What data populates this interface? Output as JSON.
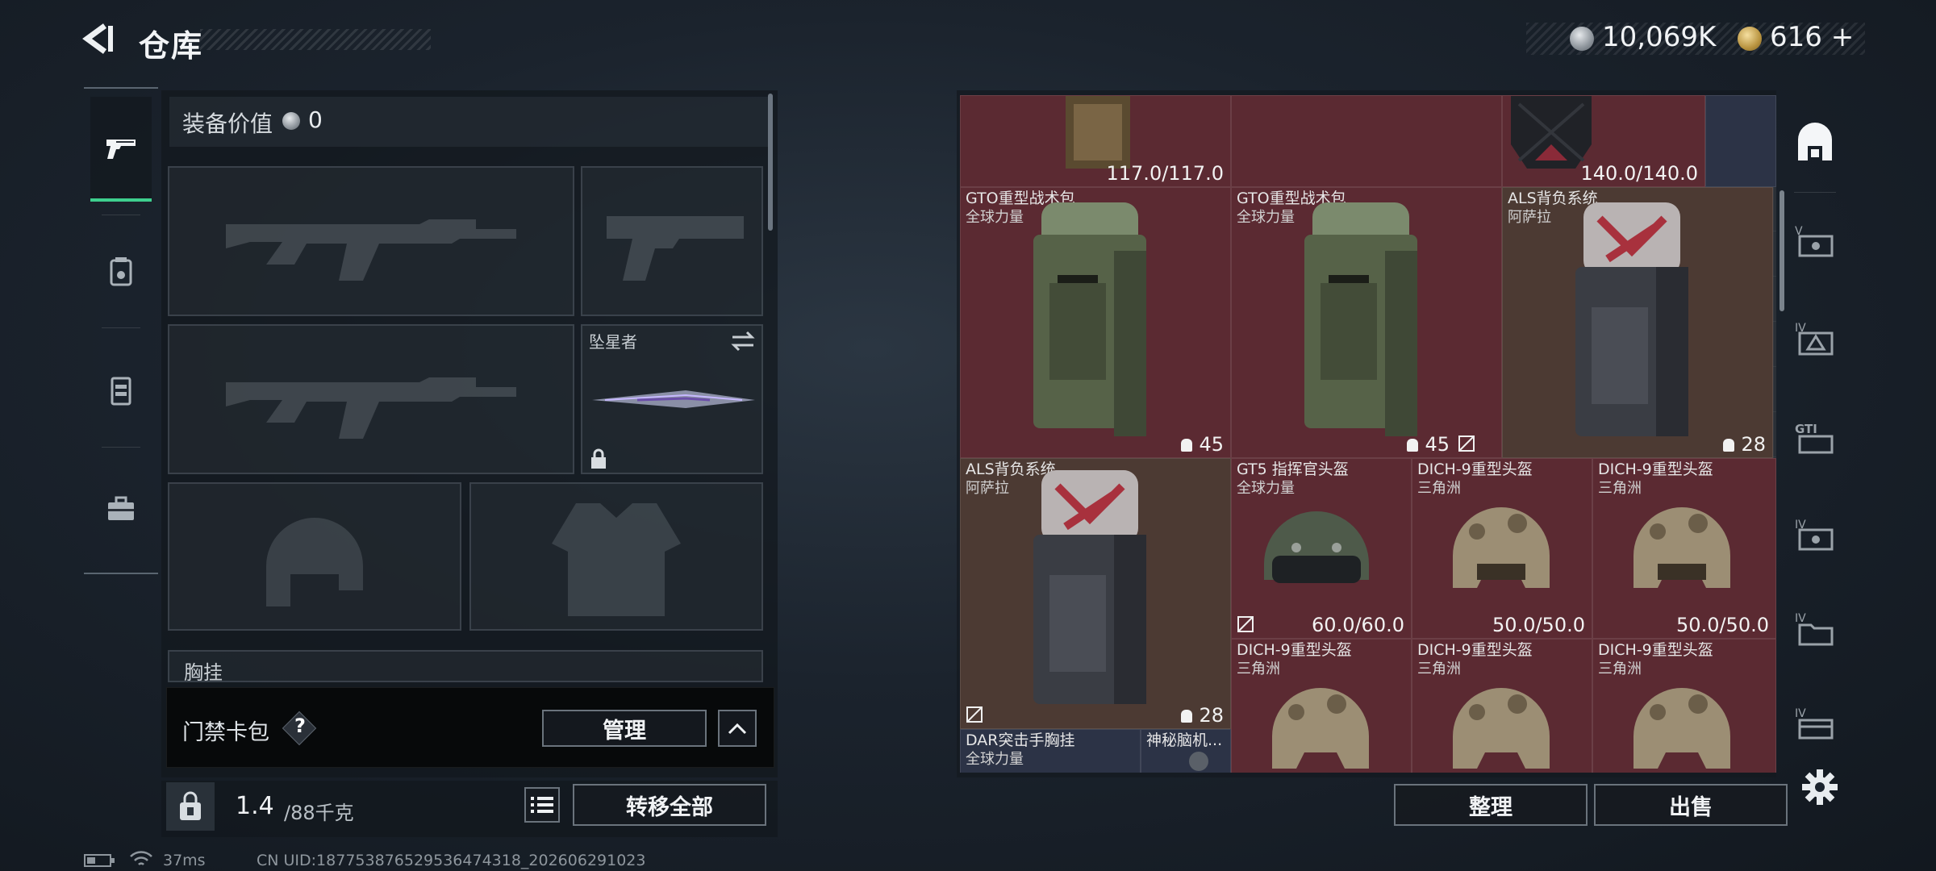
{
  "header": {
    "title": "仓库",
    "currency": {
      "silver": "10,069K",
      "gold": "616",
      "gold_add": "+"
    }
  },
  "left_rail": [
    {
      "name": "tab-weapons",
      "icon": "pistol-icon",
      "active": true
    },
    {
      "name": "tab-armor",
      "icon": "backpack-armor-icon",
      "active": false
    },
    {
      "name": "tab-rig",
      "icon": "chest-rig-icon",
      "active": false
    },
    {
      "name": "tab-case",
      "icon": "briefcase-icon",
      "active": false
    }
  ],
  "equipment": {
    "value_label": "装备价值",
    "value": "0",
    "melee_name": "坠星者",
    "partial_label": "胸挂",
    "access_card_label": "门禁卡包",
    "help_glyph": "?",
    "manage_label": "管理",
    "weight_current": "1.4",
    "weight_max": "/88千克",
    "transfer_all_label": "转移全部"
  },
  "grid_items": [
    {
      "name": "",
      "sub": "",
      "dur": "117.0/117.0",
      "cap": ""
    },
    {
      "name": "",
      "sub": "",
      "dur": "140.0/140.0",
      "cap": ""
    },
    {
      "name": "GTO重型战术包",
      "sub": "全球力量",
      "dur": "",
      "cap": "45"
    },
    {
      "name": "GTO重型战术包",
      "sub": "全球力量",
      "dur": "",
      "cap": "45"
    },
    {
      "name": "ALS背负系统",
      "sub": "阿萨拉",
      "dur": "",
      "cap": "28"
    },
    {
      "name": "ALS背负系统",
      "sub": "阿萨拉",
      "dur": "",
      "cap": "28"
    },
    {
      "name": "GT5 指挥官头盔",
      "sub": "全球力量",
      "dur": "60.0/60.0",
      "cap": ""
    },
    {
      "name": "DICH-9重型头盔",
      "sub": "三角洲",
      "dur": "50.0/50.0",
      "cap": ""
    },
    {
      "name": "DICH-9重型头盔",
      "sub": "三角洲",
      "dur": "50.0/50.0",
      "cap": ""
    },
    {
      "name": "DICH-9重型头盔",
      "sub": "三角洲",
      "dur": "",
      "cap": ""
    },
    {
      "name": "DICH-9重型头盔",
      "sub": "三角洲",
      "dur": "",
      "cap": ""
    },
    {
      "name": "DICH-9重型头盔",
      "sub": "三角洲",
      "dur": "",
      "cap": ""
    },
    {
      "name": "DAR突击手胸挂",
      "sub": "全球力量",
      "dur": "",
      "cap": ""
    },
    {
      "name": "神秘脑机...",
      "sub": "",
      "dur": "",
      "cap": ""
    }
  ],
  "actions": {
    "sort_label": "整理",
    "sell_label": "出售"
  },
  "right_rail": [
    {
      "name": "filter-all",
      "icon": "warehouse-all-icon"
    },
    {
      "name": "filter-5",
      "icon": "v-case-icon"
    },
    {
      "name": "filter-4a",
      "icon": "iv-triangle-icon"
    },
    {
      "name": "filter-gti",
      "icon": "gti-icon"
    },
    {
      "name": "filter-4b",
      "icon": "iv-case-icon"
    },
    {
      "name": "filter-4c",
      "icon": "iv-folder-icon"
    },
    {
      "name": "filter-4d",
      "icon": "iv-box-icon"
    }
  ],
  "status_bar": {
    "ping": "37ms",
    "uid": "CN UID:18775387652953647431​8_202606291023"
  },
  "colors": {
    "accent": "#3ecf8e",
    "item_red": "#5b2a32",
    "item_brown": "#4c3a33"
  }
}
